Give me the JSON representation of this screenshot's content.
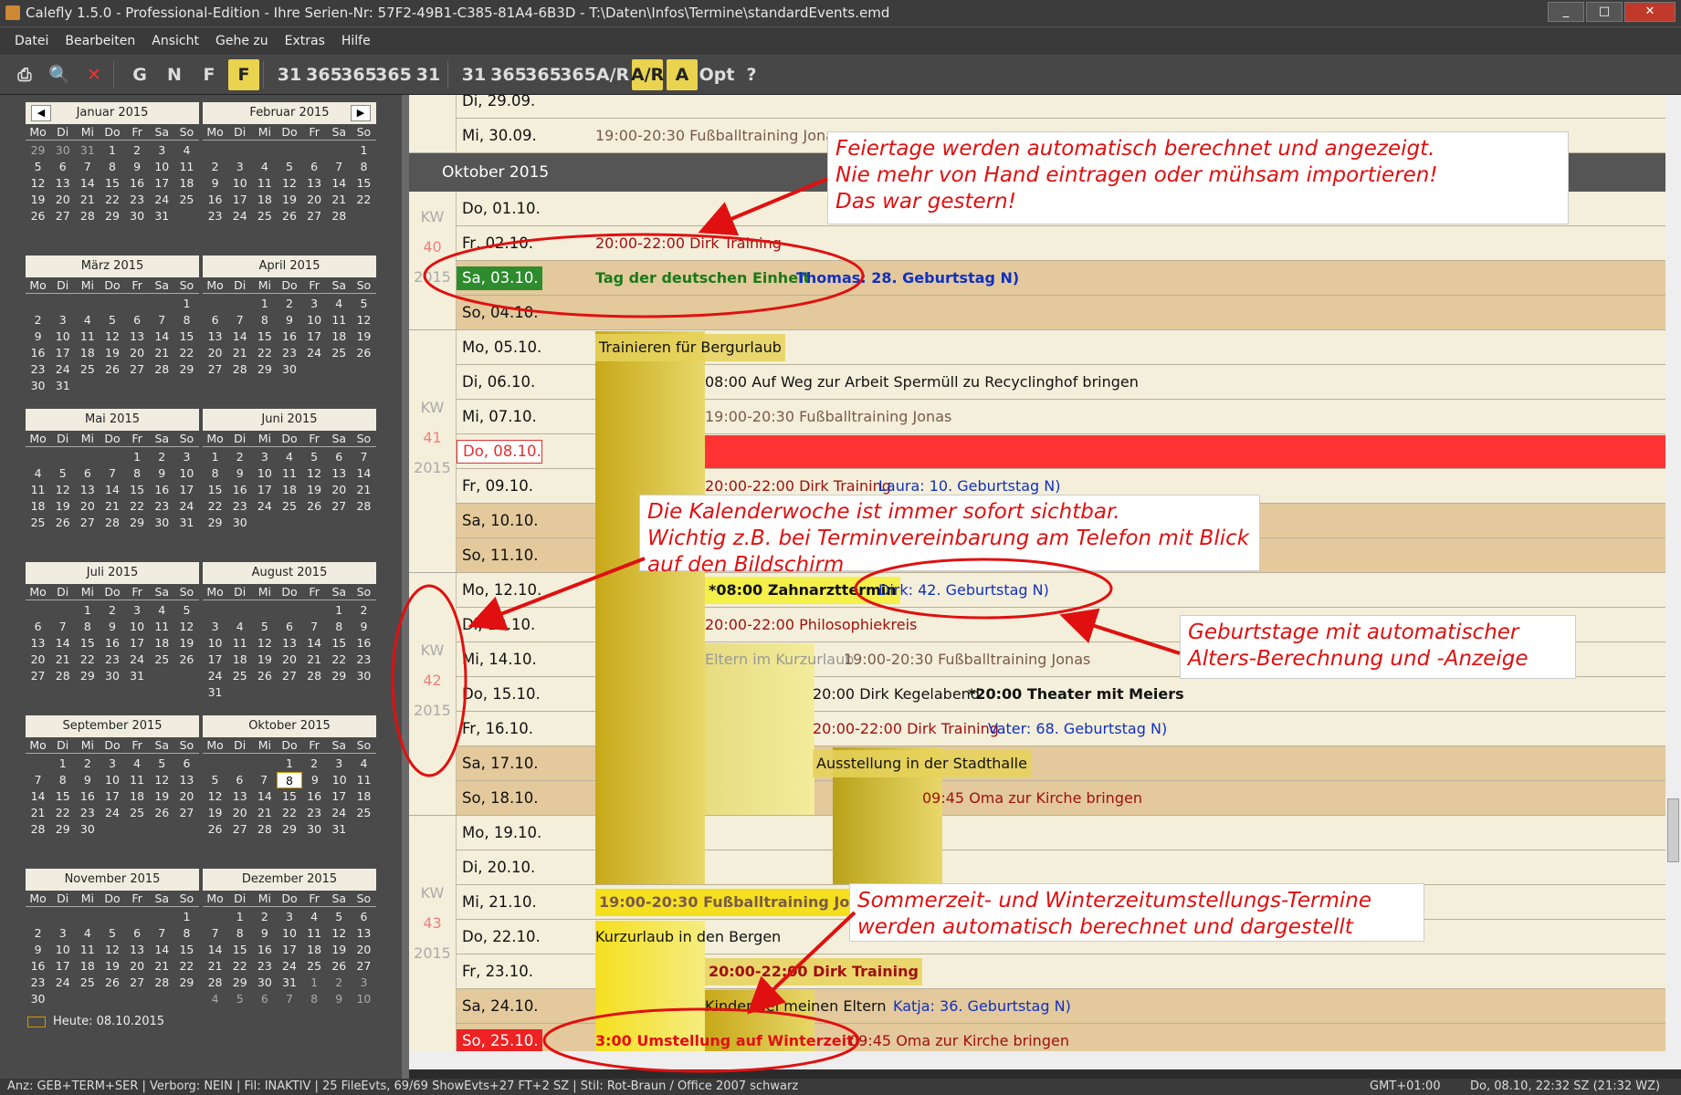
{
  "window": {
    "title": "Calefly 1.5.0 - Professional-Edition - Ihre Serien-Nr: 57F2-49B1-C385-81A4-6B3D - T:\\Daten\\Infos\\Termine\\standardEvents.emd"
  },
  "menu": [
    "Datei",
    "Bearbeiten",
    "Ansicht",
    "Gehe zu",
    "Extras",
    "Hilfe"
  ],
  "toolbar": [
    "G",
    "N",
    "F",
    "F",
    "31",
    "365",
    "365",
    "365",
    "31",
    "31",
    "365",
    "365",
    "365",
    "A/R",
    "A/R",
    "A",
    "Opt",
    "?"
  ],
  "weekdays": [
    "Mo",
    "Di",
    "Mi",
    "Do",
    "Fr",
    "Sa",
    "So"
  ],
  "months": [
    {
      "name": "Januar 2015",
      "rows": [
        [
          "29",
          "30",
          "31",
          "1",
          "2",
          "3",
          "4"
        ],
        [
          "5",
          "6",
          "7",
          "8",
          "9",
          "10",
          "11"
        ],
        [
          "12",
          "13",
          "14",
          "15",
          "16",
          "17",
          "18"
        ],
        [
          "19",
          "20",
          "21",
          "22",
          "23",
          "24",
          "25"
        ],
        [
          "26",
          "27",
          "28",
          "29",
          "30",
          "31",
          ""
        ]
      ]
    },
    {
      "name": "Februar 2015",
      "rows": [
        [
          "",
          "",
          "",
          "",
          "",
          "",
          "1"
        ],
        [
          "2",
          "3",
          "4",
          "5",
          "6",
          "7",
          "8"
        ],
        [
          "9",
          "10",
          "11",
          "12",
          "13",
          "14",
          "15"
        ],
        [
          "16",
          "17",
          "18",
          "19",
          "20",
          "21",
          "22"
        ],
        [
          "23",
          "24",
          "25",
          "26",
          "27",
          "28",
          ""
        ]
      ]
    },
    {
      "name": "März 2015",
      "rows": [
        [
          "",
          "",
          "",
          "",
          "",
          "",
          "1"
        ],
        [
          "2",
          "3",
          "4",
          "5",
          "6",
          "7",
          "8"
        ],
        [
          "9",
          "10",
          "11",
          "12",
          "13",
          "14",
          "15"
        ],
        [
          "16",
          "17",
          "18",
          "19",
          "20",
          "21",
          "22"
        ],
        [
          "23",
          "24",
          "25",
          "26",
          "27",
          "28",
          "29"
        ],
        [
          "30",
          "31",
          "",
          "",
          "",
          "",
          ""
        ]
      ]
    },
    {
      "name": "April 2015",
      "rows": [
        [
          "",
          "",
          "1",
          "2",
          "3",
          "4",
          "5"
        ],
        [
          "6",
          "7",
          "8",
          "9",
          "10",
          "11",
          "12"
        ],
        [
          "13",
          "14",
          "15",
          "16",
          "17",
          "18",
          "19"
        ],
        [
          "20",
          "21",
          "22",
          "23",
          "24",
          "25",
          "26"
        ],
        [
          "27",
          "28",
          "29",
          "30",
          "",
          "",
          ""
        ]
      ]
    },
    {
      "name": "Mai 2015",
      "rows": [
        [
          "",
          "",
          "",
          "",
          "1",
          "2",
          "3"
        ],
        [
          "4",
          "5",
          "6",
          "7",
          "8",
          "9",
          "10"
        ],
        [
          "11",
          "12",
          "13",
          "14",
          "15",
          "16",
          "17"
        ],
        [
          "18",
          "19",
          "20",
          "21",
          "22",
          "23",
          "24"
        ],
        [
          "25",
          "26",
          "27",
          "28",
          "29",
          "30",
          "31"
        ]
      ]
    },
    {
      "name": "Juni 2015",
      "rows": [
        [
          "1",
          "2",
          "3",
          "4",
          "5",
          "6",
          "7"
        ],
        [
          "8",
          "9",
          "10",
          "11",
          "12",
          "13",
          "14"
        ],
        [
          "15",
          "16",
          "17",
          "18",
          "19",
          "20",
          "21"
        ],
        [
          "22",
          "23",
          "24",
          "25",
          "26",
          "27",
          "28"
        ],
        [
          "29",
          "30",
          "",
          "",
          "",
          "",
          ""
        ]
      ]
    },
    {
      "name": "Juli 2015",
      "rows": [
        [
          "",
          "",
          "1",
          "2",
          "3",
          "4",
          "5"
        ],
        [
          "6",
          "7",
          "8",
          "9",
          "10",
          "11",
          "12"
        ],
        [
          "13",
          "14",
          "15",
          "16",
          "17",
          "18",
          "19"
        ],
        [
          "20",
          "21",
          "22",
          "23",
          "24",
          "25",
          "26"
        ],
        [
          "27",
          "28",
          "29",
          "30",
          "31",
          "",
          ""
        ]
      ]
    },
    {
      "name": "August 2015",
      "rows": [
        [
          "",
          "",
          "",
          "",
          "",
          "1",
          "2"
        ],
        [
          "3",
          "4",
          "5",
          "6",
          "7",
          "8",
          "9"
        ],
        [
          "10",
          "11",
          "12",
          "13",
          "14",
          "15",
          "16"
        ],
        [
          "17",
          "18",
          "19",
          "20",
          "21",
          "22",
          "23"
        ],
        [
          "24",
          "25",
          "26",
          "27",
          "28",
          "29",
          "30"
        ],
        [
          "31",
          "",
          "",
          "",
          "",
          "",
          ""
        ]
      ]
    },
    {
      "name": "September 2015",
      "rows": [
        [
          "",
          "1",
          "2",
          "3",
          "4",
          "5",
          "6"
        ],
        [
          "7",
          "8",
          "9",
          "10",
          "11",
          "12",
          "13"
        ],
        [
          "14",
          "15",
          "16",
          "17",
          "18",
          "19",
          "20"
        ],
        [
          "21",
          "22",
          "23",
          "24",
          "25",
          "26",
          "27"
        ],
        [
          "28",
          "29",
          "30",
          "",
          "",
          "",
          ""
        ]
      ]
    },
    {
      "name": "Oktober 2015",
      "rows": [
        [
          "",
          "",
          "",
          "1",
          "2",
          "3",
          "4"
        ],
        [
          "5",
          "6",
          "7",
          "8",
          "9",
          "10",
          "11"
        ],
        [
          "12",
          "13",
          "14",
          "15",
          "16",
          "17",
          "18"
        ],
        [
          "19",
          "20",
          "21",
          "22",
          "23",
          "24",
          "25"
        ],
        [
          "26",
          "27",
          "28",
          "29",
          "30",
          "31",
          ""
        ]
      ]
    },
    {
      "name": "November 2015",
      "rows": [
        [
          "",
          "",
          "",
          "",
          "",
          "",
          "1"
        ],
        [
          "2",
          "3",
          "4",
          "5",
          "6",
          "7",
          "8"
        ],
        [
          "9",
          "10",
          "11",
          "12",
          "13",
          "14",
          "15"
        ],
        [
          "16",
          "17",
          "18",
          "19",
          "20",
          "21",
          "22"
        ],
        [
          "23",
          "24",
          "25",
          "26",
          "27",
          "28",
          "29"
        ],
        [
          "30",
          "",
          "",
          "",
          "",
          "",
          ""
        ]
      ]
    },
    {
      "name": "Dezember 2015",
      "rows": [
        [
          "",
          "1",
          "2",
          "3",
          "4",
          "5",
          "6"
        ],
        [
          "7",
          "8",
          "9",
          "10",
          "11",
          "12",
          "13"
        ],
        [
          "14",
          "15",
          "16",
          "17",
          "18",
          "19",
          "20"
        ],
        [
          "21",
          "22",
          "23",
          "24",
          "25",
          "26",
          "27"
        ],
        [
          "28",
          "29",
          "30",
          "31",
          "1",
          "2",
          "3"
        ],
        [
          "4",
          "5",
          "6",
          "7",
          "8",
          "9",
          "10"
        ]
      ]
    }
  ],
  "today_label": "Heute: 08.10.2015",
  "month_header": "Oktober 2015",
  "days": [
    {
      "label": "Di,  29.09.",
      "events": []
    },
    {
      "label": "Mi,  30.09.",
      "events": [
        {
          "text": "19:00-20:30 Fußballtraining Jonas",
          "color": "#7a5a4a"
        }
      ]
    },
    {
      "label": "Do,  01.10.",
      "events": []
    },
    {
      "label": "Fr,  02.10.",
      "events": [
        {
          "text": "20:00-22:00 Dirk Training",
          "color": "#a01010"
        }
      ]
    },
    {
      "label": "Sa,  03.10.",
      "events": [
        {
          "text": "Tag der deutschen Einheit",
          "color": "#1a7a1a"
        },
        {
          "text": "Thomas: 28. Geburtstag N)",
          "color": "#1030c0"
        }
      ]
    },
    {
      "label": "So,  04.10.",
      "events": []
    },
    {
      "label": "Mo, 05.10.",
      "events": [
        {
          "text": "Trainieren für Bergurlaub",
          "color": "#111"
        }
      ]
    },
    {
      "label": "Di,   06.10.",
      "events": [
        {
          "text": "08:00 Auf Weg zur Arbeit Spermüll zu Recyclinghof bringen",
          "color": "#111"
        }
      ]
    },
    {
      "label": "Mi,  07.10.",
      "events": [
        {
          "text": "19:00-20:30 Fußballtraining Jonas",
          "color": "#7a5a4a"
        }
      ]
    },
    {
      "label": "Do,  08.10.",
      "events": []
    },
    {
      "label": "Fr,   09.10.",
      "events": [
        {
          "text": "20:00-22:00 Dirk Training",
          "color": "#a01010"
        },
        {
          "text": "Laura: 10. Geburtstag N)",
          "color": "#1030c0"
        }
      ]
    },
    {
      "label": "Sa,  10.10.",
      "events": []
    },
    {
      "label": "So,  11.10.",
      "events": []
    },
    {
      "label": "Mo, 12.10.",
      "events": [
        {
          "text": "*08:00 Zahnarzttermin",
          "color": "#111"
        },
        {
          "text": "Dirk: 42. Geburtstag N)",
          "color": "#1030c0"
        }
      ]
    },
    {
      "label": "Di,  13.10.",
      "events": [
        {
          "text": "20:00-22:00 Philosophiekreis",
          "color": "#a01010"
        }
      ]
    },
    {
      "label": "Mi,  14.10.",
      "events": [
        {
          "text": "Eltern im Kurzurlaub",
          "color": "#999"
        },
        {
          "text": "19:00-20:30 Fußballtraining Jonas",
          "color": "#7a5a4a"
        }
      ]
    },
    {
      "label": "Do,  15.10.",
      "events": [
        {
          "text": "20:00 Dirk Kegelabend",
          "color": "#111"
        },
        {
          "text": "*20:00 Theater mit Meiers",
          "color": "#111"
        }
      ]
    },
    {
      "label": "Fr,   16.10.",
      "events": [
        {
          "text": "20:00-22:00 Dirk Training",
          "color": "#a01010"
        },
        {
          "text": "Vater: 68. Geburtstag N)",
          "color": "#1030c0"
        }
      ]
    },
    {
      "label": "Sa,  17.10.",
      "events": [
        {
          "text": "Ausstellung in der Stadthalle",
          "color": "#111"
        }
      ]
    },
    {
      "label": "So,  18.10.",
      "events": [
        {
          "text": "09:45 Oma zur Kirche bringen",
          "color": "#a01010"
        }
      ]
    },
    {
      "label": "Mo, 19.10.",
      "events": []
    },
    {
      "label": "Di,   20.10.",
      "events": []
    },
    {
      "label": "Mi,  21.10.",
      "events": [
        {
          "text": "19:00-20:30 Fußballtraining Jonas",
          "color": "#7a5a4a"
        }
      ]
    },
    {
      "label": "Do,  22.10.",
      "events": [
        {
          "text": "Kurzurlaub in den Bergen",
          "color": "#111"
        }
      ]
    },
    {
      "label": "Fr,   23.10.",
      "events": [
        {
          "text": "20:00-22:00 Dirk Training",
          "color": "#a01010"
        }
      ]
    },
    {
      "label": "Sa,  24.10.",
      "events": [
        {
          "text": "Kinder bei meinen Eltern",
          "color": "#111"
        },
        {
          "text": "Katja: 36. Geburtstag N)",
          "color": "#1030c0"
        }
      ]
    },
    {
      "label": "So,  25.10.",
      "events": [
        {
          "text": "3:00 Umstellung auf Winterzeit",
          "color": "#e01010"
        },
        {
          "text": "09:45 Oma zur Kirche bringen",
          "color": "#a01010"
        }
      ]
    }
  ],
  "kw": [
    {
      "kw": "KW",
      "n": "40",
      "y": "2015"
    },
    {
      "kw": "KW",
      "n": "41",
      "y": "2015"
    },
    {
      "kw": "KW",
      "n": "42",
      "y": "2015"
    },
    {
      "kw": "KW",
      "n": "43",
      "y": "2015"
    }
  ],
  "notes": [
    {
      "text": "Feiertage werden automatisch berechnet und angezeigt.\nNie mehr von Hand  eintragen oder mühsam importieren!\nDas war gestern!"
    },
    {
      "text": "Die Kalenderwoche ist immer sofort sichtbar.\nWichtig z.B. bei Terminvereinbarung am Telefon mit Blick\nauf den Bildschirm"
    },
    {
      "text": "Geburtstage mit automatischer\nAlters-Berechnung und -Anzeige"
    },
    {
      "text": "Sommerzeit- und Winterzeitumstellungs-Termine\nwerden automatisch berechnet und dargestellt"
    }
  ],
  "status": {
    "main": "Anz: GEB+TERM+SER | Verborg: NEIN | Fil: INAKTIV | 25 FileEvts, 69/69 ShowEvts+27 FT+2 SZ | Stil: Rot-Braun / Office 2007 schwarz",
    "gmt": "GMT+01:00",
    "time": "Do, 08.10, 22:32 SZ (21:32 WZ)"
  }
}
